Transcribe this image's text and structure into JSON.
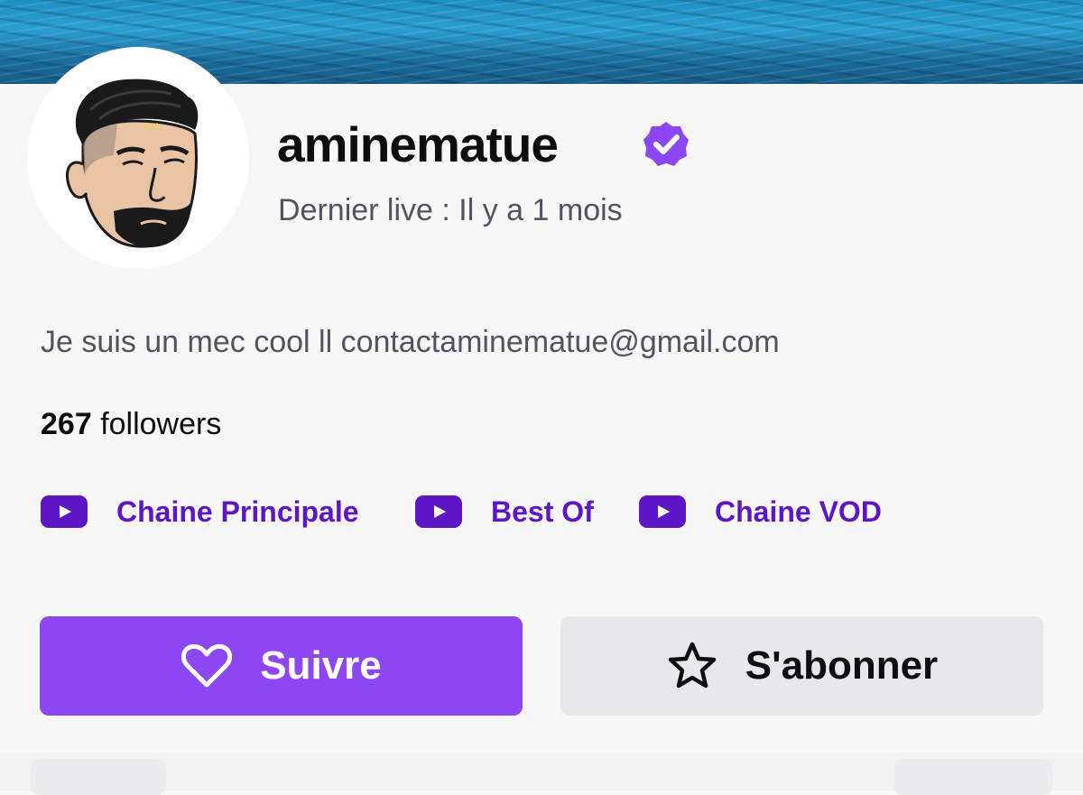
{
  "profile": {
    "username": "aminematue",
    "last_live": "Dernier live : Il y a 1 mois",
    "bio": "Je suis un mec cool ll contactaminematue@gmail.com",
    "followers_count": "267",
    "followers_label": "followers"
  },
  "links": [
    {
      "label": "Chaine Principale",
      "icon": "youtube-icon"
    },
    {
      "label": "Best Of",
      "icon": "youtube-icon"
    },
    {
      "label": "Chaine VOD",
      "icon": "youtube-icon"
    }
  ],
  "actions": {
    "follow_label": "Suivre",
    "follow_icon": "heart-icon",
    "subscribe_label": "S'abonner",
    "subscribe_icon": "star-icon"
  },
  "colors": {
    "accent": "#8c47f2",
    "link": "#5c16c5",
    "verified": "#8c47f2"
  }
}
